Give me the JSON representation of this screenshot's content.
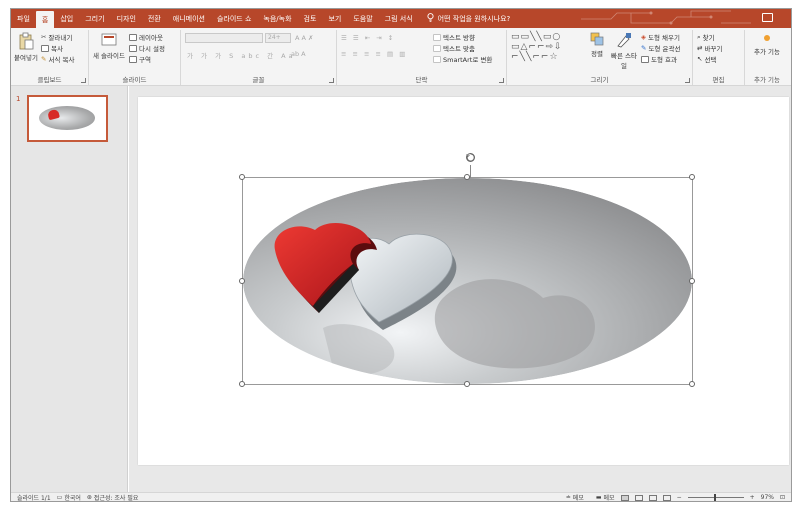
{
  "tabs": [
    "파일",
    "홈",
    "삽입",
    "그리기",
    "디자인",
    "전환",
    "애니메이션",
    "슬라이드 쇼",
    "녹음/녹화",
    "검토",
    "보기",
    "도움말",
    "그림 서식"
  ],
  "tell_me": "어떤 작업을 원하시나요?",
  "ribbon": {
    "clipboard": {
      "label": "클립보드",
      "paste": "붙여넣기",
      "cut": "잘라내기",
      "copy": "복사",
      "format_painter": "서식 복사"
    },
    "slides": {
      "label": "슬라이드",
      "new_slide": "새 슬라이드",
      "layout": "레이아웃",
      "reset": "다시 설정",
      "section": "구역"
    },
    "font": {
      "label": "글꼴",
      "size": "24+"
    },
    "paragraph": {
      "label": "단락",
      "text_direction": "텍스트 방향",
      "align_text": "텍스트 맞춤",
      "smartart": "SmartArt로 변환"
    },
    "drawing": {
      "label": "그리기",
      "arrange": "정렬",
      "quick_styles": "빠른 스타일",
      "shape_fill": "도형 채우기",
      "shape_outline": "도형 윤곽선",
      "shape_effects": "도형 효과"
    },
    "editing": {
      "label": "편집",
      "find": "찾기",
      "replace": "바꾸기",
      "select": "선택"
    },
    "addins": {
      "label": "추가 기능",
      "button": "추가 기능"
    }
  },
  "thumbnail": {
    "number": "1"
  },
  "status": {
    "slide": "슬라이드 1/1",
    "language": "한국어",
    "accessibility": "접근성: 조사 필요",
    "notes": "메모",
    "comments": "메모",
    "zoom": "97%"
  },
  "colors": {
    "accent": "#b7472a",
    "heart_red": "#d72a26",
    "heart_silver": "#cfd5d9"
  }
}
